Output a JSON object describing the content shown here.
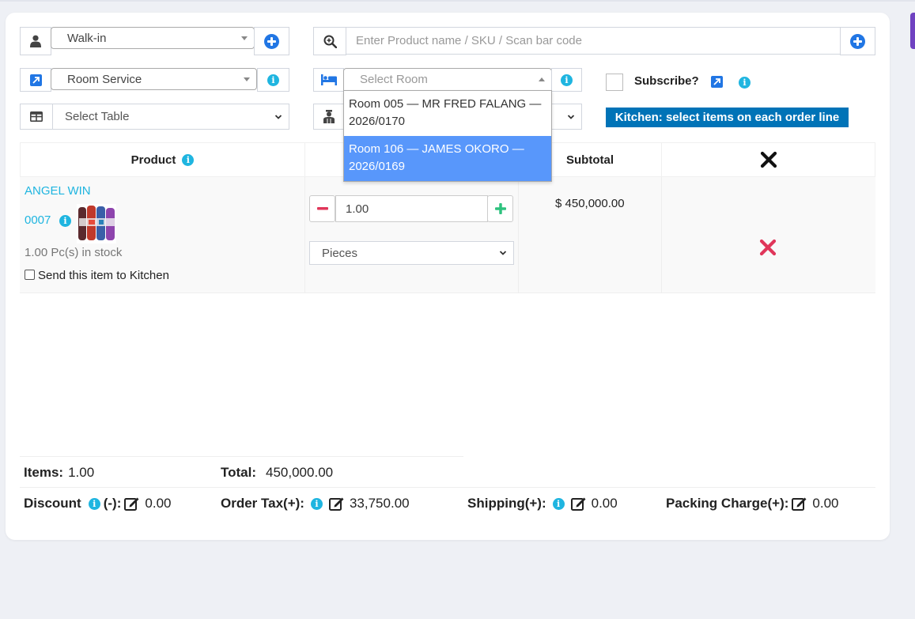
{
  "customer": {
    "selected": "Walk-in"
  },
  "product_search": {
    "placeholder": "Enter Product name / SKU / Scan bar code"
  },
  "service_type": {
    "selected": "Room Service"
  },
  "room": {
    "placeholder": "Select Room",
    "options": [
      {
        "label": "Room 005 — MR FRED FALANG — 2026/0170"
      },
      {
        "label": "Room 106 — JAMES OKORO — 2026/0169",
        "highlighted": true
      }
    ]
  },
  "subscribe": {
    "label": "Subscribe?"
  },
  "table_select": {
    "selected": "Select Table"
  },
  "kitchen_badge": "Kitchen: select items on each order line",
  "order_table": {
    "headers": {
      "product": "Product",
      "subtotal": "Subtotal"
    },
    "rows": [
      {
        "name": "ANGEL WIN",
        "sku": "0007",
        "stock": "1.00 Pc(s) in stock",
        "kitchen_label": "Send this item to Kitchen",
        "quantity": "1.00",
        "unit": "Pieces",
        "subtotal": "$ 450,000.00"
      }
    ]
  },
  "totals": {
    "items_label": "Items:",
    "items_value": "1.00",
    "total_label": "Total:",
    "total_value": "450,000.00",
    "discount_label": "Discount",
    "discount_suffix": "(-):",
    "discount_value": "0.00",
    "tax_label": "Order Tax(+):",
    "tax_value": "33,750.00",
    "shipping_label": "Shipping(+):",
    "shipping_value": "0.00",
    "packing_label": "Packing Charge(+):",
    "packing_value": "0.00"
  },
  "colors": {
    "accent": "#2176e4",
    "info": "#1fb5e0",
    "badge": "#0073b7",
    "minus": "#e0365a",
    "plus": "#2ec27e",
    "highlight": "#5897fb"
  }
}
